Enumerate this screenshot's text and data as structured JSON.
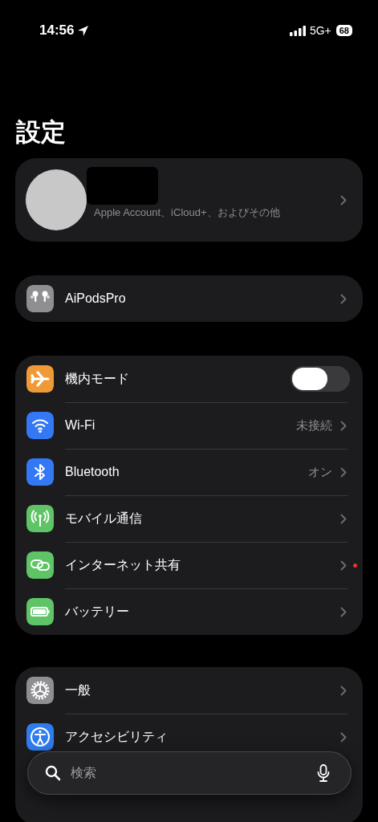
{
  "status_bar": {
    "time": "14:56",
    "network": "5G+",
    "battery": "68"
  },
  "title": "設定",
  "account": {
    "subtitle": "Apple Account、iCloud+、およびその他"
  },
  "groups": [
    {
      "rows": [
        {
          "kind": "nav",
          "label": "AiPodsPro",
          "color": "#8e8e93"
        }
      ]
    },
    {
      "rows": [
        {
          "kind": "toggle",
          "label": "機内モード",
          "color": "#f09a37",
          "on": false
        },
        {
          "kind": "value",
          "label": "Wi-Fi",
          "value": "未接続",
          "color": "#3478f6"
        },
        {
          "kind": "value",
          "label": "Bluetooth",
          "value": "オン",
          "color": "#3478f6"
        },
        {
          "kind": "nav",
          "label": "モバイル通信",
          "color": "#5fc466"
        },
        {
          "kind": "nav",
          "label": "インターネット共有",
          "color": "#5fc466",
          "badge": true
        },
        {
          "kind": "nav",
          "label": "バッテリー",
          "color": "#5fc466"
        }
      ]
    },
    {
      "rows": [
        {
          "kind": "nav",
          "label": "一般",
          "color": "#8e8e93"
        },
        {
          "kind": "nav",
          "label": "アクセシビリティ",
          "color": "#2f7cf0"
        }
      ]
    }
  ],
  "search": {
    "placeholder": "検索"
  }
}
